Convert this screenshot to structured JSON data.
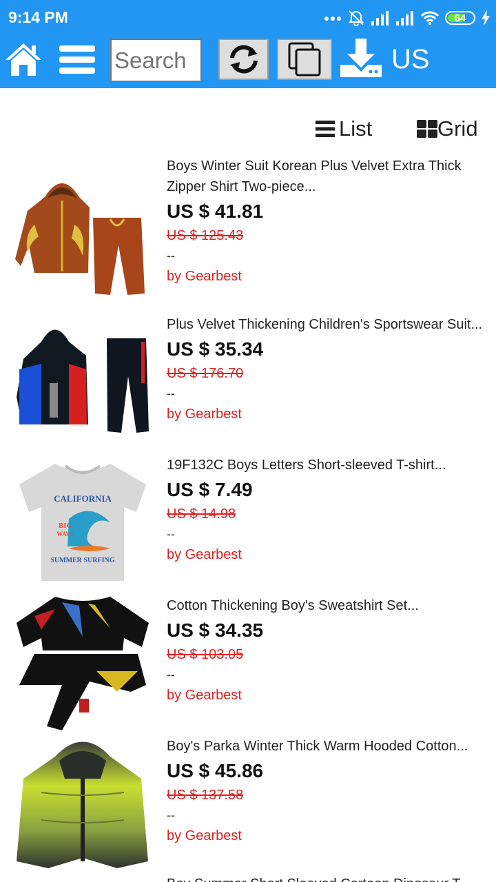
{
  "status_bar": {
    "time": "9:14 PM",
    "battery": "64",
    "icons": [
      "more-dots-icon",
      "alarm-off-icon",
      "signal-1-icon",
      "signal-2-icon",
      "wifi-icon",
      "battery-icon",
      "charging-bolt-icon"
    ]
  },
  "toolbar": {
    "search_placeholder": "Search",
    "currency": "US",
    "icons": [
      "home-icon",
      "menu-icon",
      "refresh-icon",
      "copy-icon",
      "download-icon"
    ]
  },
  "view": {
    "list_label": "List",
    "grid_label": "Grid"
  },
  "products": [
    {
      "title": "Boys Winter Suit Korean Plus Velvet Extra Thick Zipper Shirt Two-piece...",
      "price": "US $ 41.81",
      "original_price": "US $ 125.43",
      "extra": "--",
      "seller": "by Gearbest"
    },
    {
      "title": "Plus Velvet Thickening Children's Sportswear Suit...",
      "price": "US $ 35.34",
      "original_price": "US $ 176.70",
      "extra": "--",
      "seller": "by Gearbest"
    },
    {
      "title": "19F132C Boys Letters Short-sleeved T-shirt...",
      "price": "US $ 7.49",
      "original_price": "US $ 14.98",
      "extra": "--",
      "seller": "by Gearbest",
      "image_text": [
        "CALIFORNIA",
        "BIG",
        "WAVE",
        "SUMMER SURFING"
      ]
    },
    {
      "title": "Cotton Thickening Boy's Sweatshirt Set...",
      "price": "US $ 34.35",
      "original_price": "US $ 103.05",
      "extra": "--",
      "seller": "by Gearbest"
    },
    {
      "title": "Boy's Parka Winter Thick Warm Hooded Cotton...",
      "price": "US $ 45.86",
      "original_price": "US $ 137.58",
      "extra": "--",
      "seller": "by Gearbest"
    },
    {
      "title": "Boy Summer Short Sleeved Cartoon Dinosaur T..."
    }
  ],
  "colors": {
    "header": "#2196f3",
    "price": "#111111",
    "original_price": "#e02020",
    "seller": "#e02020"
  }
}
